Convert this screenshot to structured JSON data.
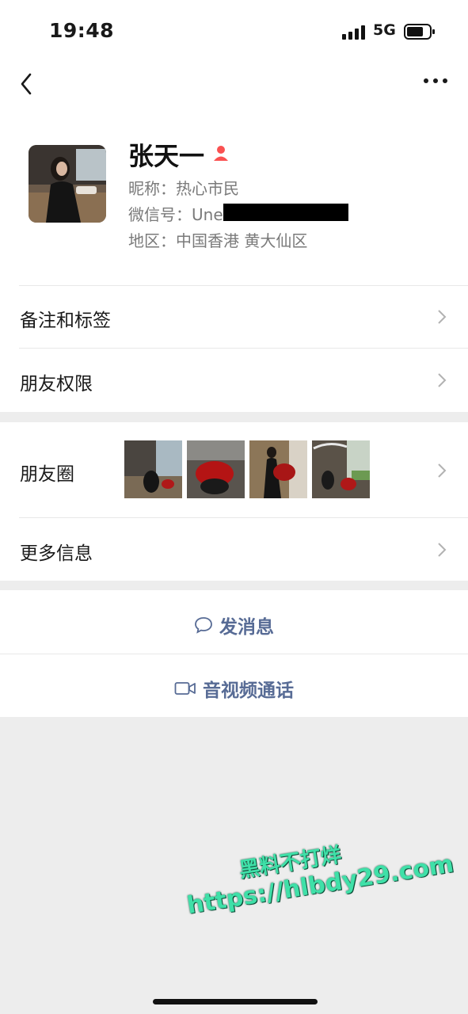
{
  "status_bar": {
    "time": "19:48",
    "network": "5G"
  },
  "header": {
    "back_icon": "chevron-left-icon",
    "more_icon": "ellipsis-icon"
  },
  "profile": {
    "name": "张天一",
    "gender_icon": "female-person-icon",
    "nickname_line": "昵称：热心市民",
    "wechat_id_line": "微信号：Une",
    "region_line": "地区：中国香港 黄大仙区"
  },
  "menu": {
    "remarks_tags": "备注和标签",
    "friend_permissions": "朋友权限",
    "moments": "朋友圈",
    "more_info": "更多信息"
  },
  "actions": {
    "send_message": "发消息",
    "video_call": "音视频通话"
  },
  "colors": {
    "link_blue": "#576b95",
    "background_gray": "#ededed",
    "gender_red": "#fa5151"
  },
  "watermark": {
    "line1": "黑料不打烊",
    "line2": "https://hlbdy29.com"
  }
}
